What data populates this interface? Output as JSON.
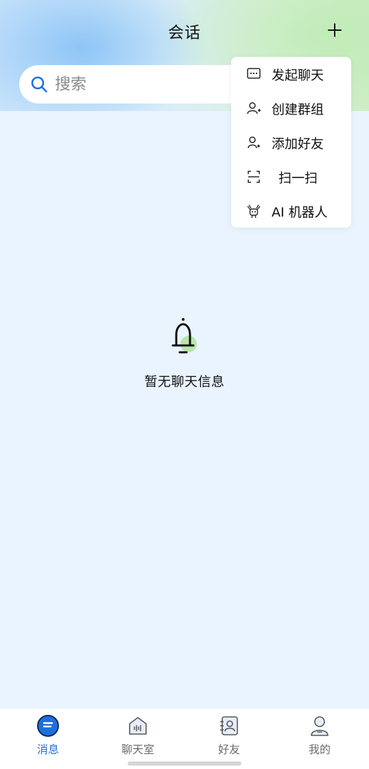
{
  "header": {
    "title": "会话"
  },
  "search": {
    "placeholder": "搜索"
  },
  "menu": {
    "items": [
      {
        "label": "发起聊天",
        "icon": "chat-bubble-icon"
      },
      {
        "label": "创建群组",
        "icon": "create-group-icon"
      },
      {
        "label": "添加好友",
        "icon": "add-friend-icon"
      },
      {
        "label": "扫一扫",
        "icon": "scan-icon"
      },
      {
        "label": "AI 机器人",
        "icon": "robot-icon"
      }
    ]
  },
  "empty_state": {
    "text": "暂无聊天信息",
    "icon": "bell-icon"
  },
  "tabbar": {
    "tabs": [
      {
        "label": "消息",
        "icon": "message-icon",
        "active": true
      },
      {
        "label": "聊天室",
        "icon": "chatroom-icon",
        "active": false
      },
      {
        "label": "好友",
        "icon": "contacts-icon",
        "active": false
      },
      {
        "label": "我的",
        "icon": "profile-icon",
        "active": false
      }
    ]
  },
  "colors": {
    "accent": "#1f6fde",
    "background": "#eaf4fe",
    "text": "#111111",
    "muted": "#6b6b6b"
  }
}
